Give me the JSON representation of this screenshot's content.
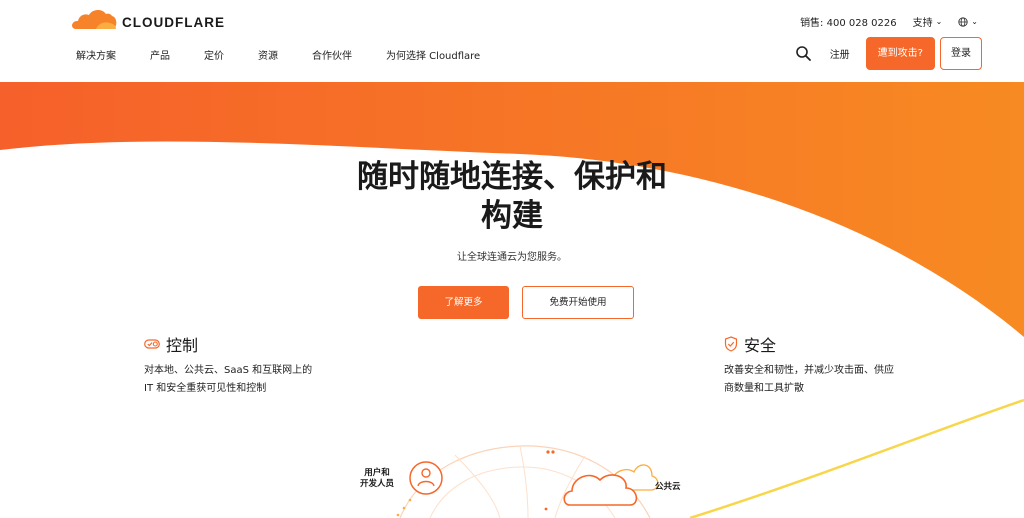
{
  "brand": {
    "name": "CLOUDFLARE",
    "color": "#f6682a"
  },
  "topbar": {
    "sales": "销售: 400 028 0226",
    "support": "支持",
    "language_icon": "globe-icon"
  },
  "nav": {
    "items": [
      "解决方案",
      "产品",
      "定价",
      "资源",
      "合作伙伴",
      "为何选择 Cloudflare"
    ]
  },
  "actions": {
    "search_icon": "search-icon",
    "signup": "注册",
    "under_attack": "遭到攻击?",
    "login": "登录"
  },
  "hero": {
    "title_line1": "随时随地连接、保护和",
    "title_line2": "构建",
    "subtitle": "让全球连通云为您服务。",
    "primary_button": "了解更多",
    "secondary_button": "免费开始使用"
  },
  "features": {
    "control": {
      "icon": "toggle-check-icon",
      "title": "控制",
      "line1": "对本地、公共云、SaaS 和互联网上的",
      "line2": "IT 和安全重获可见性和控制"
    },
    "security": {
      "icon": "shield-check-icon",
      "title": "安全",
      "line1": "改善安全和韧性，并减少攻击面、供应",
      "line2": "商数量和工具扩散"
    }
  },
  "diagram": {
    "dev_label_line1": "用户和",
    "dev_label_line2": "开发人员",
    "cloud_label": "公共云"
  }
}
